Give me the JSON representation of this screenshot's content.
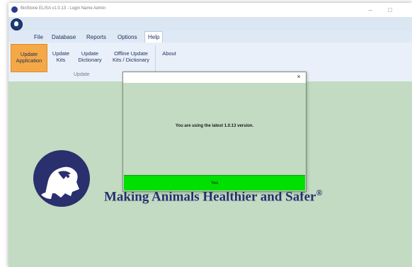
{
  "window": {
    "title": "BioStone ELISA v1.0.13 - Login Name Admin",
    "minimize_glyph": "–",
    "maximize_glyph": "□"
  },
  "menu": [
    "File",
    "Database",
    "Reports",
    "Options",
    "Help"
  ],
  "ribbon": {
    "buttons": [
      {
        "label_l1": "Update",
        "label_l2": "Application"
      },
      {
        "label_l1": "Update",
        "label_l2": "Kits"
      },
      {
        "label_l1": "Update",
        "label_l2": "Dictionary"
      },
      {
        "label_l1": "Offline Update",
        "label_l2": "Kits / Dictionary"
      },
      {
        "label_l1": "About",
        "label_l2": ""
      }
    ],
    "group_label": "Update"
  },
  "tagline": {
    "text": "Making Animals Healthier and Safer",
    "mark": "®"
  },
  "dialog": {
    "close_glyph": "×",
    "message": "You are using the latest 1.0.13 version.",
    "yes_label": "Yes"
  },
  "colors": {
    "content_bg": "#c2dbc2",
    "accent_orange": "#f5a847",
    "yes_green": "#00e000",
    "brand_navy": "#2a2f6e"
  },
  "icons": [
    "app-logo-icon",
    "lion-logo-icon",
    "close-icon",
    "minimize-icon",
    "maximize-icon"
  ]
}
